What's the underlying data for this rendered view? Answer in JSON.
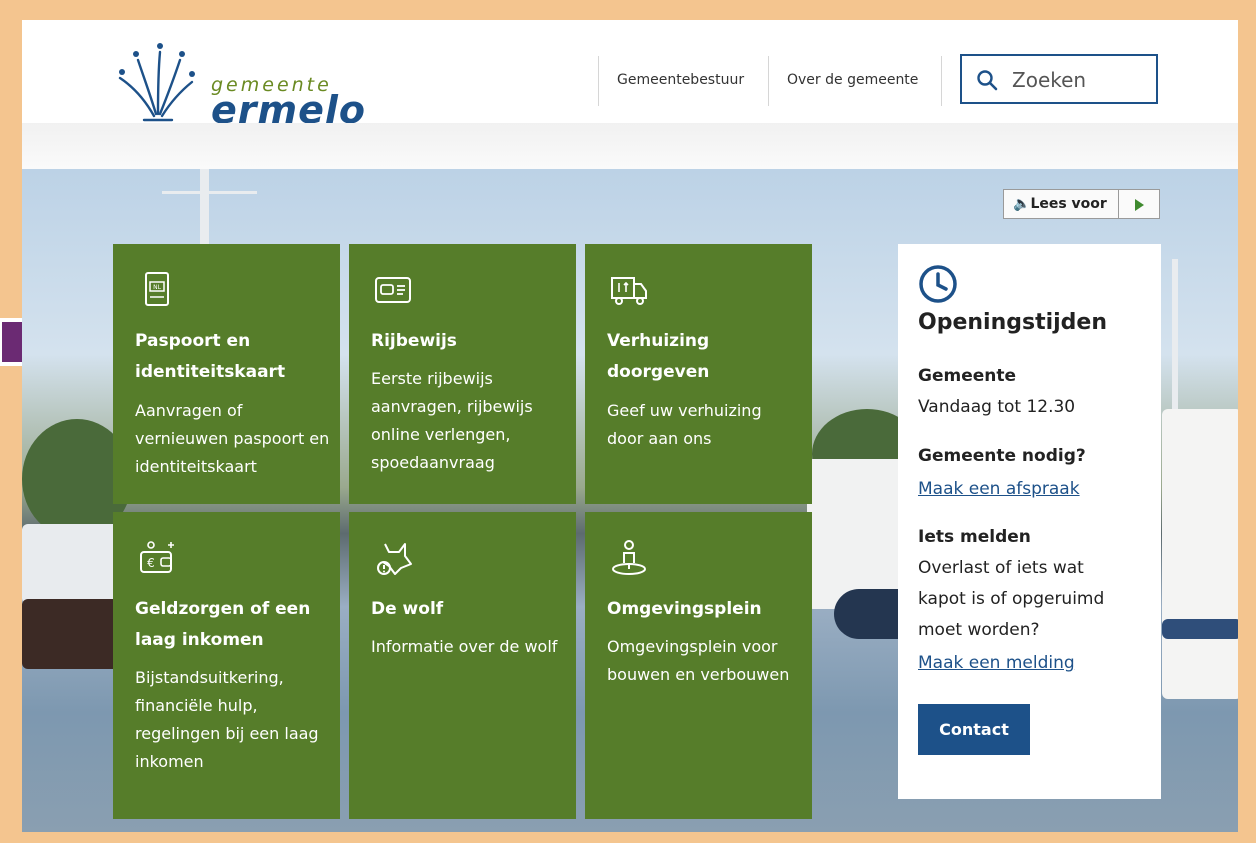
{
  "logo": {
    "gemeente": "gemeente",
    "name": "ermelo"
  },
  "nav": {
    "items": [
      "Gemeentebestuur",
      "Over de gemeente"
    ]
  },
  "search": {
    "placeholder": "Zoeken"
  },
  "readspeaker": {
    "label": "Lees voor"
  },
  "tiles": [
    {
      "title": "Paspoort en identiteitskaart",
      "desc": "Aanvragen of vernieuwen paspoort en identiteitskaart",
      "icon": "passport-icon"
    },
    {
      "title": "Rijbewijs",
      "desc": "Eerste rijbewijs aanvragen, rijbewijs online verlengen, spoedaanvraag",
      "icon": "driving-license-icon"
    },
    {
      "title": "Verhuizing doorgeven",
      "desc": "Geef uw verhuizing door aan ons",
      "icon": "moving-truck-icon"
    },
    {
      "title": "Geldzorgen of een laag inkomen",
      "desc": "Bijstandsuitkering, financiële hulp, regelingen bij een laag inkomen",
      "icon": "wallet-euro-icon"
    },
    {
      "title": "De wolf",
      "desc": "Informatie over de wolf",
      "icon": "wolf-icon"
    },
    {
      "title": "Omgevingsplein",
      "desc": "Omgevingsplein voor bouwen en verbouwen",
      "icon": "location-person-icon"
    }
  ],
  "openings": {
    "title": "Openingstijden",
    "gemeente_heading": "Gemeente",
    "gemeente_text": "Vandaag tot 12.30",
    "nodig_heading": "Gemeente nodig?",
    "afspraak_link": "Maak een afspraak",
    "melden_heading": "Iets melden",
    "melden_text_1": "Overlast of iets wat",
    "melden_text_2": "kapot is of opgeruimd",
    "melden_text_3": "moet worden?",
    "melding_link": "Maak een melding",
    "contact_button": "Contact"
  },
  "colors": {
    "tile_green": "#567d2a",
    "brand_blue": "#1d5189",
    "frame": "#f4c58f",
    "annotation_arrow": "#6b2a73"
  }
}
